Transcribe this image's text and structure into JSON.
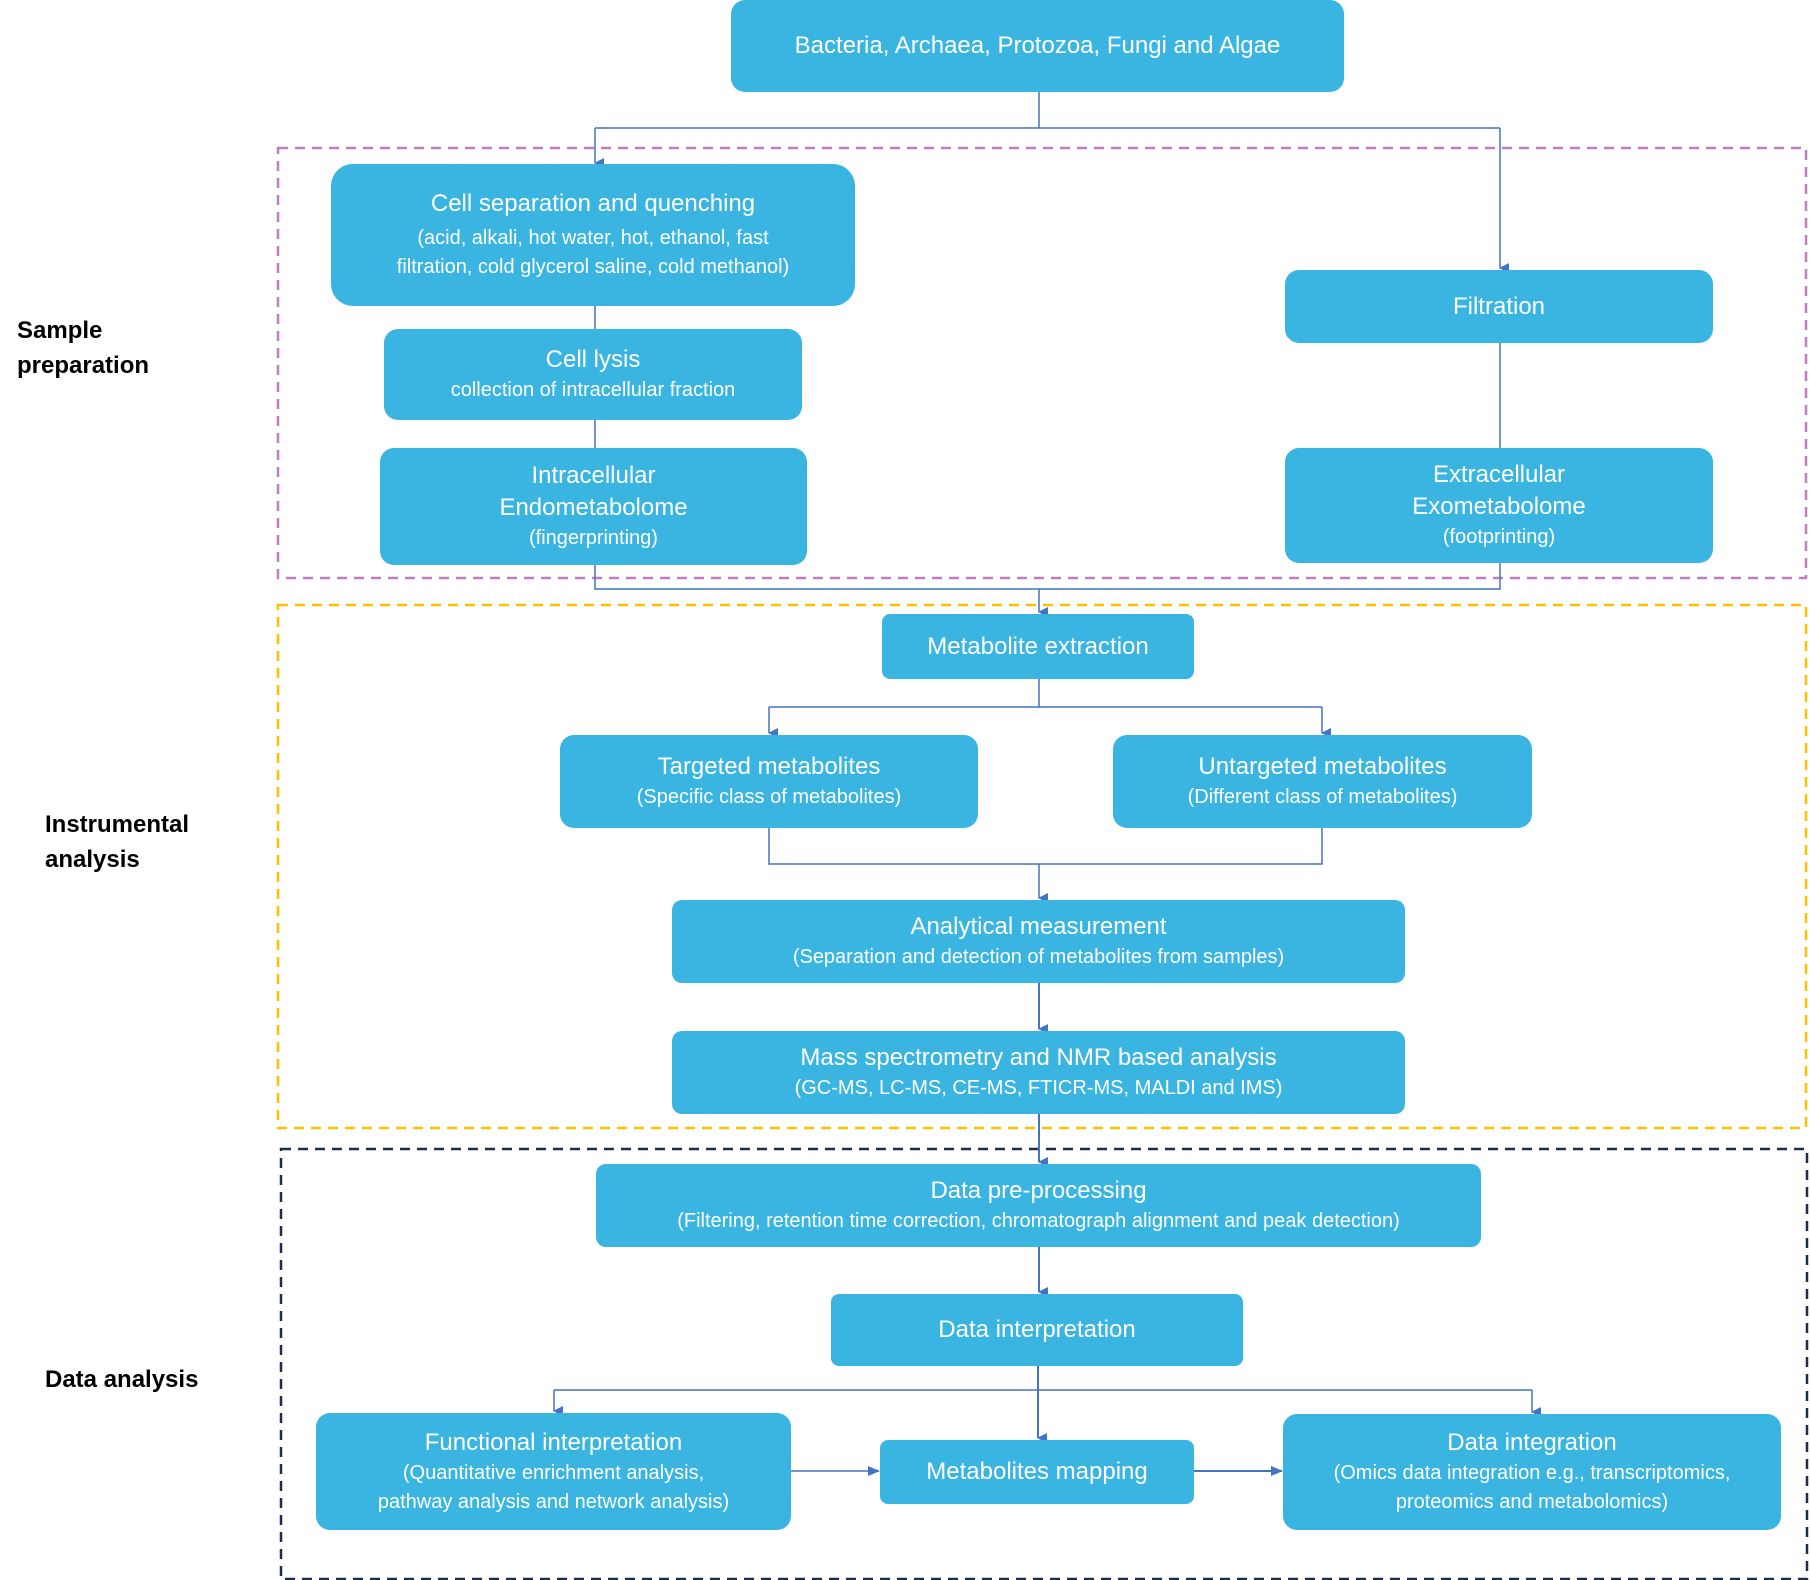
{
  "colors": {
    "box": "#3AB5E1",
    "connector": "#4472C4",
    "sample_prep_border": "#C07EC0",
    "instrumental_border": "#FFC000",
    "data_analysis_border": "#1F2D4D"
  },
  "sections": {
    "sample_preparation": [
      "Sample",
      "preparation"
    ],
    "instrumental_analysis": [
      "Instrumental",
      "analysis"
    ],
    "data_analysis": [
      "Data analysis"
    ]
  },
  "nodes": {
    "organisms": {
      "title": "Bacteria, Archaea, Protozoa, Fungi and Algae"
    },
    "cell_separation": {
      "title": "Cell separation and quenching",
      "sub": [
        "(acid, alkali, hot water, hot, ethanol, fast",
        "filtration, cold glycerol saline, cold methanol)"
      ]
    },
    "cell_lysis": {
      "title": "Cell lysis",
      "sub": [
        "collection of intracellular fraction"
      ]
    },
    "intracellular": {
      "title": [
        "Intracellular",
        "Endometabolome"
      ],
      "sub": [
        "(fingerprinting)"
      ]
    },
    "filtration": {
      "title": "Filtration"
    },
    "extracellular": {
      "title": [
        "Extracellular",
        "Exometabolome"
      ],
      "sub": [
        "(footprinting)"
      ]
    },
    "metabolite_extraction": {
      "title": "Metabolite extraction"
    },
    "targeted": {
      "title": "Targeted metabolites",
      "sub": [
        "(Specific class of metabolites)"
      ]
    },
    "untargeted": {
      "title": "Untargeted metabolites",
      "sub": [
        "(Different class of metabolites)"
      ]
    },
    "analytical": {
      "title": "Analytical measurement",
      "sub": [
        "(Separation and detection of metabolites from samples)"
      ]
    },
    "mass_spec": {
      "title": "Mass spectrometry and NMR based analysis",
      "sub": [
        "(GC-MS, LC-MS, CE-MS, FTICR-MS, MALDI and IMS)"
      ]
    },
    "preprocessing": {
      "title": "Data pre-processing",
      "sub": [
        "(Filtering, retention time correction, chromatograph alignment and peak detection)"
      ]
    },
    "interpretation": {
      "title": "Data interpretation"
    },
    "functional": {
      "title": "Functional interpretation",
      "sub": [
        "(Quantitative enrichment analysis,",
        "pathway analysis and network analysis)"
      ]
    },
    "mapping": {
      "title": "Metabolites mapping"
    },
    "integration": {
      "title": "Data integration",
      "sub": [
        "(Omics data integration e.g., transcriptomics,",
        "proteomics and metabolomics)"
      ]
    }
  }
}
